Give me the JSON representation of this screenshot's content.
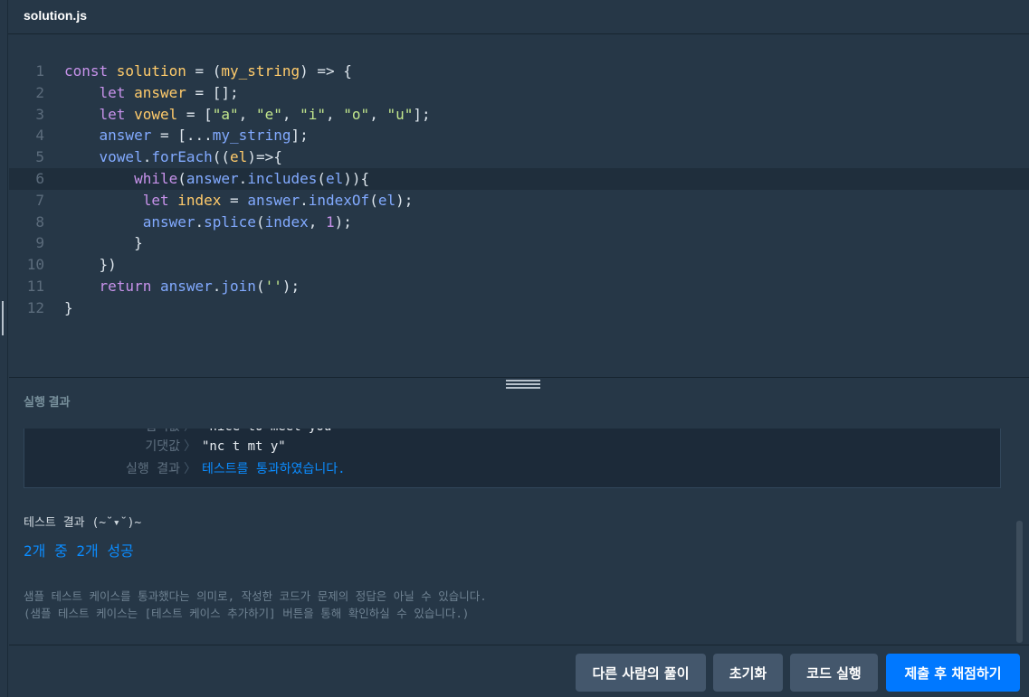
{
  "editor": {
    "filename": "solution.js",
    "active_line": 6,
    "lines": [
      {
        "n": "1",
        "tokens": [
          [
            "kw",
            "const "
          ],
          [
            "fn",
            "solution"
          ],
          [
            "pn",
            " = ("
          ],
          [
            "fn",
            "my_string"
          ],
          [
            "pn",
            ") => {"
          ]
        ]
      },
      {
        "n": "2",
        "tokens": [
          [
            "pn",
            "    "
          ],
          [
            "kw",
            "let "
          ],
          [
            "fn",
            "answer"
          ],
          [
            "pn",
            " = [];"
          ]
        ]
      },
      {
        "n": "3",
        "tokens": [
          [
            "pn",
            "    "
          ],
          [
            "kw",
            "let "
          ],
          [
            "fn",
            "vowel"
          ],
          [
            "pn",
            " = ["
          ],
          [
            "st",
            "\"a\""
          ],
          [
            "pn",
            ", "
          ],
          [
            "st",
            "\"e\""
          ],
          [
            "pn",
            ", "
          ],
          [
            "st",
            "\"i\""
          ],
          [
            "pn",
            ", "
          ],
          [
            "st",
            "\"o\""
          ],
          [
            "pn",
            ", "
          ],
          [
            "st",
            "\"u\""
          ],
          [
            "pn",
            "];"
          ]
        ]
      },
      {
        "n": "4",
        "tokens": [
          [
            "pn",
            "    "
          ],
          [
            "vr",
            "answer"
          ],
          [
            "pn",
            " = [..."
          ],
          [
            "vr",
            "my_string"
          ],
          [
            "pn",
            "];"
          ]
        ]
      },
      {
        "n": "5",
        "tokens": [
          [
            "pn",
            "    "
          ],
          [
            "vr",
            "vowel"
          ],
          [
            "pn",
            "."
          ],
          [
            "vr",
            "forEach"
          ],
          [
            "pn",
            "(("
          ],
          [
            "fn",
            "el"
          ],
          [
            "pn",
            ")=>{"
          ]
        ]
      },
      {
        "n": "6",
        "tokens": [
          [
            "pn",
            "        "
          ],
          [
            "kw",
            "while"
          ],
          [
            "pn",
            "("
          ],
          [
            "vr",
            "answer"
          ],
          [
            "pn",
            "."
          ],
          [
            "vr",
            "includes"
          ],
          [
            "pn",
            "("
          ],
          [
            "vr",
            "el"
          ],
          [
            "pn",
            "))"
          ],
          [
            "pn",
            "{"
          ]
        ]
      },
      {
        "n": "7",
        "tokens": [
          [
            "pn",
            "         "
          ],
          [
            "kw",
            "let "
          ],
          [
            "fn",
            "index"
          ],
          [
            "pn",
            " = "
          ],
          [
            "vr",
            "answer"
          ],
          [
            "pn",
            "."
          ],
          [
            "vr",
            "indexOf"
          ],
          [
            "pn",
            "("
          ],
          [
            "vr",
            "el"
          ],
          [
            "pn",
            ");"
          ]
        ]
      },
      {
        "n": "8",
        "tokens": [
          [
            "pn",
            "         "
          ],
          [
            "vr",
            "answer"
          ],
          [
            "pn",
            "."
          ],
          [
            "vr",
            "splice"
          ],
          [
            "pn",
            "("
          ],
          [
            "vr",
            "index"
          ],
          [
            "pn",
            ", "
          ],
          [
            "kw",
            "1"
          ],
          [
            "pn",
            ");"
          ]
        ]
      },
      {
        "n": "9",
        "tokens": [
          [
            "pn",
            "        }"
          ]
        ]
      },
      {
        "n": "10",
        "tokens": [
          [
            "pn",
            "    })"
          ]
        ]
      },
      {
        "n": "11",
        "tokens": [
          [
            "pn",
            "    "
          ],
          [
            "kw",
            "return "
          ],
          [
            "vr",
            "answer"
          ],
          [
            "pn",
            "."
          ],
          [
            "vr",
            "join"
          ],
          [
            "pn",
            "("
          ],
          [
            "st",
            "''"
          ],
          [
            "pn",
            ");"
          ]
        ]
      },
      {
        "n": "12",
        "tokens": [
          [
            "pn",
            "}"
          ]
        ]
      }
    ]
  },
  "results": {
    "section_title": "실행 결과",
    "rows": [
      {
        "label": "입력값",
        "value": "\"nice to meet you\"",
        "status": "normal"
      },
      {
        "label": "기댓값",
        "value": "\"nc t mt y\"",
        "status": "normal"
      },
      {
        "label": "실행 결과",
        "value": "테스트를 통과하였습니다.",
        "status": "ok"
      }
    ],
    "summary_title": "테스트 결과 (~˘▾˘)~",
    "summary_count": "2개 중 2개 성공",
    "note_line1": "샘플 테스트 케이스를 통과했다는 의미로, 작성한 코드가 문제의 정답은 아닐 수 있습니다.",
    "note_line2": "(샘플 테스트 케이스는 [테스트 케이스 추가하기] 버튼을 통해 확인하실 수 있습니다.)"
  },
  "buttons": {
    "others": "다른 사람의 풀이",
    "reset": "초기화",
    "run": "코드 실행",
    "submit": "제출 후 채점하기"
  }
}
